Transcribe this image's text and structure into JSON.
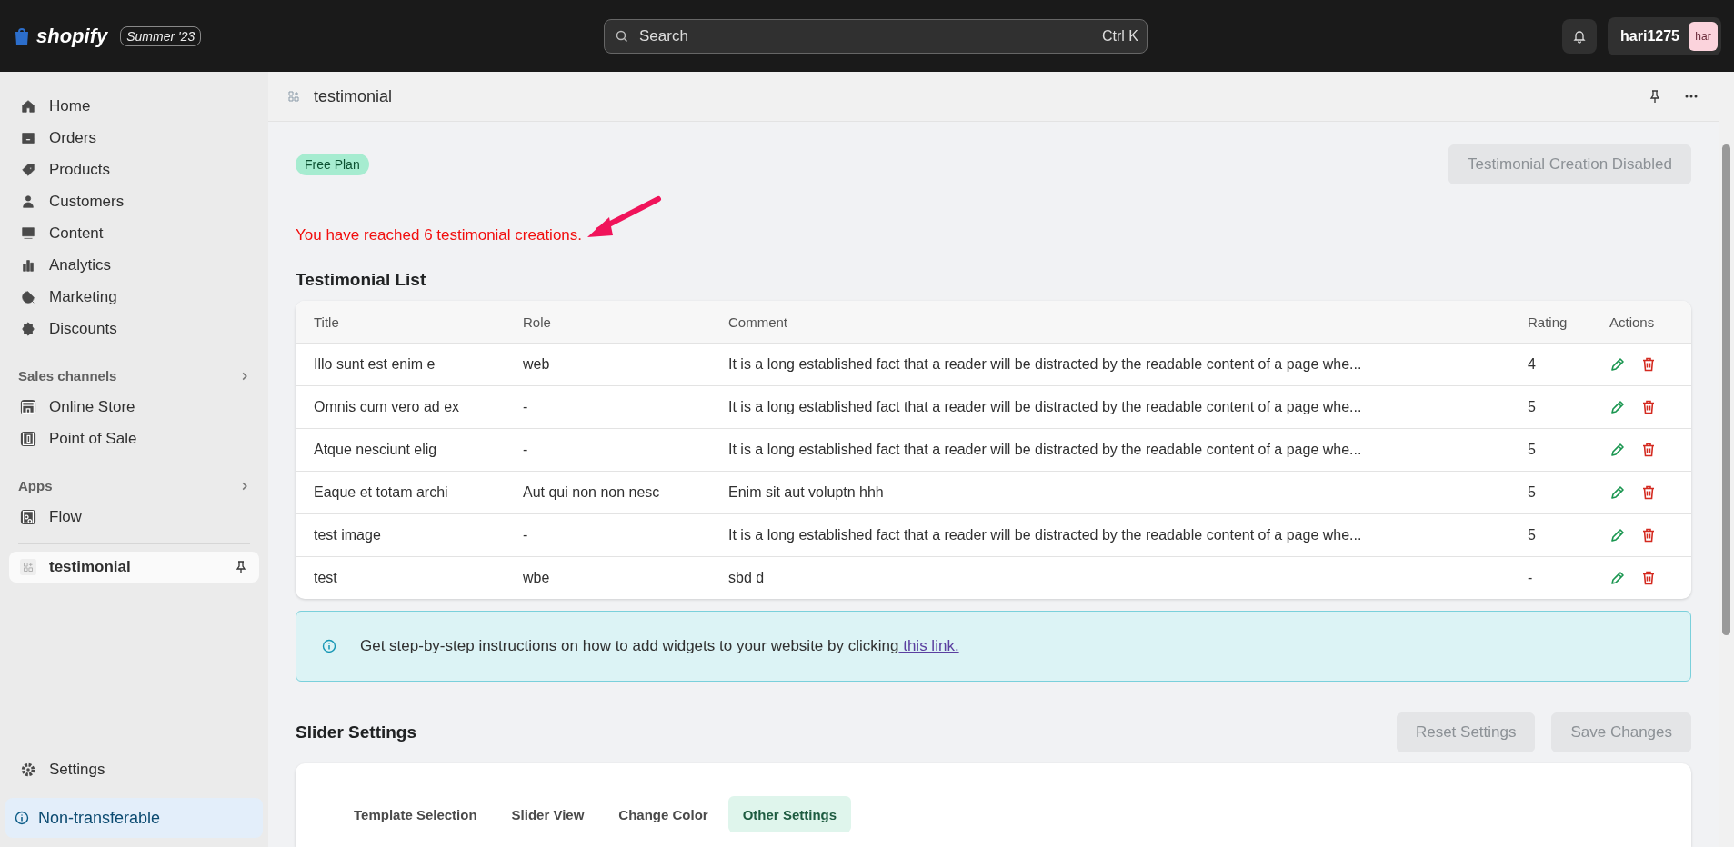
{
  "topbar": {
    "logo": "shopify",
    "edition": "Summer '23",
    "search": {
      "placeholder": "Search",
      "shortcut": "Ctrl K"
    },
    "user": {
      "name": "hari1275",
      "initials": "har"
    }
  },
  "sidebar": {
    "main": [
      {
        "label": "Home",
        "selected": false
      },
      {
        "label": "Orders",
        "selected": false
      },
      {
        "label": "Products",
        "selected": false
      },
      {
        "label": "Customers",
        "selected": false
      },
      {
        "label": "Content",
        "selected": false
      },
      {
        "label": "Analytics",
        "selected": false
      },
      {
        "label": "Marketing",
        "selected": false
      },
      {
        "label": "Discounts",
        "selected": false
      }
    ],
    "sections": [
      {
        "title": "Sales channels",
        "items": [
          {
            "label": "Online Store",
            "selected": false
          },
          {
            "label": "Point of Sale",
            "selected": false
          }
        ]
      },
      {
        "title": "Apps",
        "items": [
          {
            "label": "Flow",
            "selected": false
          }
        ]
      }
    ],
    "app": {
      "label": "testimonial",
      "selected": true
    },
    "settings": "Settings",
    "notice": "Non-transferable"
  },
  "page": {
    "title": "testimonial",
    "plan": "Free Plan",
    "create_button": {
      "label": "Testimonial Creation Disabled",
      "disabled": true
    },
    "limit_message": "You have reached 6 testimonial creations."
  },
  "table": {
    "title": "Testimonial List",
    "columns": [
      "Title",
      "Role",
      "Comment",
      "Rating",
      "Actions"
    ],
    "rows": [
      {
        "title": "Illo sunt est enim e",
        "role": "web",
        "comment": "It is a long established fact that a reader will be distracted by the readable content of a page whe...",
        "rating": "4"
      },
      {
        "title": "Omnis cum vero ad ex",
        "role": "-",
        "comment": "It is a long established fact that a reader will be distracted by the readable content of a page whe...",
        "rating": "5"
      },
      {
        "title": "Atque nesciunt elig",
        "role": "-",
        "comment": "It is a long established fact that a reader will be distracted by the readable content of a page whe...",
        "rating": "5"
      },
      {
        "title": "Eaque et totam archi",
        "role": "Aut qui non non nesc",
        "comment": "Enim sit aut voluptn hhh",
        "rating": "5"
      },
      {
        "title": "test image",
        "role": "-",
        "comment": "It is a long established fact that a reader will be distracted by the readable content of a page whe...",
        "rating": "5"
      },
      {
        "title": "test",
        "role": "wbe",
        "comment": "sbd d",
        "rating": "-"
      }
    ]
  },
  "banner": {
    "text": "Get step-by-step instructions on how to add widgets to your website by clicking",
    "link": " this link."
  },
  "slider_settings": {
    "title": "Slider Settings",
    "buttons": [
      {
        "label": "Reset Settings",
        "disabled": true
      },
      {
        "label": "Save Changes",
        "disabled": true
      }
    ],
    "tabs": [
      {
        "label": "Template Selection",
        "selected": false
      },
      {
        "label": "Slider View",
        "selected": false
      },
      {
        "label": "Change Color",
        "selected": false
      },
      {
        "label": "Other Settings",
        "selected": true
      }
    ]
  }
}
